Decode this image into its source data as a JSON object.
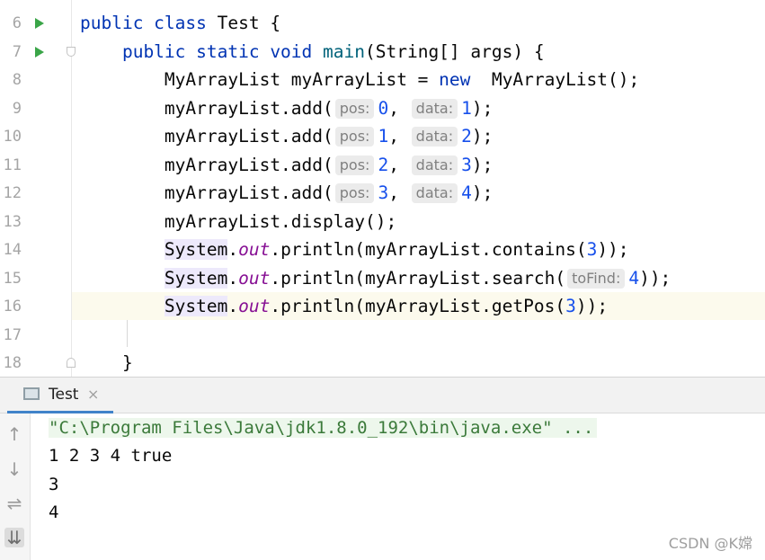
{
  "editor": {
    "lines": [
      {
        "num": "6",
        "code": [
          {
            "t": "public class ",
            "c": "kw"
          },
          {
            "t": "Test {"
          }
        ]
      },
      {
        "num": "7",
        "code": [
          {
            "t": "    public static void ",
            "c": "kw"
          },
          {
            "t": "main",
            "c": "fn"
          },
          {
            "t": "(String[] args) {"
          }
        ]
      },
      {
        "num": "8",
        "code": [
          {
            "t": "        MyArrayList myArrayList = "
          },
          {
            "t": "new",
            "c": "kw"
          },
          {
            "t": "  MyArrayList();"
          }
        ]
      },
      {
        "num": "9",
        "code": [
          {
            "t": "        myArrayList.add("
          },
          {
            "hint": "pos:"
          },
          {
            "t": "0",
            "c": "num"
          },
          {
            "t": ", "
          },
          {
            "hint": "data:"
          },
          {
            "t": "1",
            "c": "num"
          },
          {
            "t": ");"
          }
        ]
      },
      {
        "num": "10",
        "code": [
          {
            "t": "        myArrayList.add("
          },
          {
            "hint": "pos:"
          },
          {
            "t": "1",
            "c": "num"
          },
          {
            "t": ", "
          },
          {
            "hint": "data:"
          },
          {
            "t": "2",
            "c": "num"
          },
          {
            "t": ");"
          }
        ]
      },
      {
        "num": "11",
        "code": [
          {
            "t": "        myArrayList.add("
          },
          {
            "hint": "pos:"
          },
          {
            "t": "2",
            "c": "num"
          },
          {
            "t": ", "
          },
          {
            "hint": "data:"
          },
          {
            "t": "3",
            "c": "num"
          },
          {
            "t": ");"
          }
        ]
      },
      {
        "num": "12",
        "code": [
          {
            "t": "        myArrayList.add("
          },
          {
            "hint": "pos:"
          },
          {
            "t": "3",
            "c": "num"
          },
          {
            "t": ", "
          },
          {
            "hint": "data:"
          },
          {
            "t": "4",
            "c": "num"
          },
          {
            "t": ");"
          }
        ]
      },
      {
        "num": "13",
        "code": [
          {
            "t": "        myArrayList.display();"
          }
        ]
      },
      {
        "num": "14",
        "code": [
          {
            "t": "        "
          },
          {
            "t": "System",
            "c": "sys"
          },
          {
            "t": "."
          },
          {
            "t": "out",
            "c": "fld"
          },
          {
            "t": ".println(myArrayList.contains("
          },
          {
            "t": "3",
            "c": "num"
          },
          {
            "t": "));"
          }
        ]
      },
      {
        "num": "15",
        "code": [
          {
            "t": "        "
          },
          {
            "t": "System",
            "c": "sys"
          },
          {
            "t": "."
          },
          {
            "t": "out",
            "c": "fld"
          },
          {
            "t": ".println(myArrayList.search("
          },
          {
            "hint": "toFind:"
          },
          {
            "t": "4",
            "c": "num"
          },
          {
            "t": "));"
          }
        ]
      },
      {
        "num": "16",
        "code": [
          {
            "t": "        "
          },
          {
            "t": "System",
            "c": "sys"
          },
          {
            "t": "."
          },
          {
            "t": "out",
            "c": "fld"
          },
          {
            "t": ".println(myArrayList.getPos("
          },
          {
            "t": "3",
            "c": "num"
          },
          {
            "t": "));"
          }
        ]
      },
      {
        "num": "17",
        "code": []
      },
      {
        "num": "18",
        "code": [
          {
            "t": "    }"
          }
        ]
      }
    ]
  },
  "run_panel": {
    "tab_label": "Test",
    "tab_close": "×",
    "tools": {
      "up": "↑",
      "down": "↓",
      "wrap": "⇌",
      "scroll": "⇊"
    },
    "console": [
      "\"C:\\Program Files\\Java\\jdk1.8.0_192\\bin\\java.exe\" ...",
      "1 2 3 4 true",
      "3",
      "4"
    ]
  },
  "watermark": "CSDN @K嫦"
}
